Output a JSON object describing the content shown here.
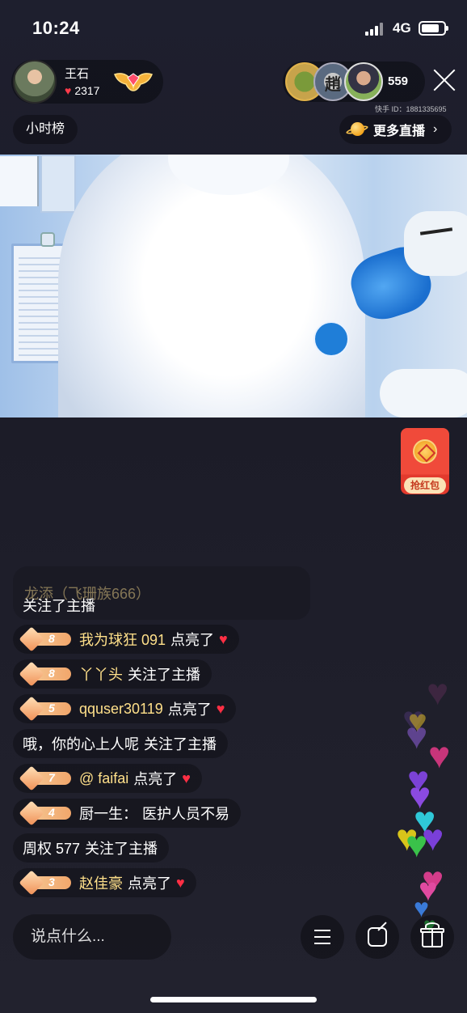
{
  "status_bar": {
    "time": "10:24",
    "network": "4G"
  },
  "host": {
    "name": "王石",
    "likes": "2317"
  },
  "viewers": {
    "count": "559",
    "avatar_2_char": "趙"
  },
  "kuaishou_id": "快手 ID：1881335695",
  "hour_rank": "小时榜",
  "more_live": "更多直播",
  "red_packet": {
    "label": "抢红包"
  },
  "comments": [
    {
      "level": "",
      "user": "龙添（飞珊族666）",
      "text": "关注了主播",
      "heart": false
    },
    {
      "level": "8",
      "user": "我为球狂 091",
      "text": "点亮了",
      "heart": true
    },
    {
      "level": "8",
      "user": "丫丫头",
      "text": "关注了主播",
      "heart": false
    },
    {
      "level": "5",
      "user": "qquser30119",
      "text": "点亮了",
      "heart": true
    },
    {
      "level": "",
      "user": "哦，你的心上人呢",
      "text": "关注了主播",
      "heart": false
    },
    {
      "level": "7",
      "user": "@ faifai",
      "text": "点亮了",
      "heart": true
    },
    {
      "level": "4",
      "user": "厨一生：",
      "text": "医护人员不易",
      "heart": false
    },
    {
      "level": "",
      "user": "周权 577",
      "text": "关注了主播",
      "heart": false
    },
    {
      "level": "3",
      "user": "赵佳豪",
      "text": "点亮了",
      "heart": true
    }
  ],
  "input": {
    "placeholder": "说点什么..."
  },
  "heart_glyph": "♥",
  "colors": {
    "username": "#ffe08a",
    "heart": "#ff2f44",
    "red_packet": "#f04a3a"
  },
  "icons": [
    "menu-icon",
    "share-icon",
    "gift-icon",
    "close-icon",
    "planet-icon",
    "wing-badge-icon"
  ]
}
